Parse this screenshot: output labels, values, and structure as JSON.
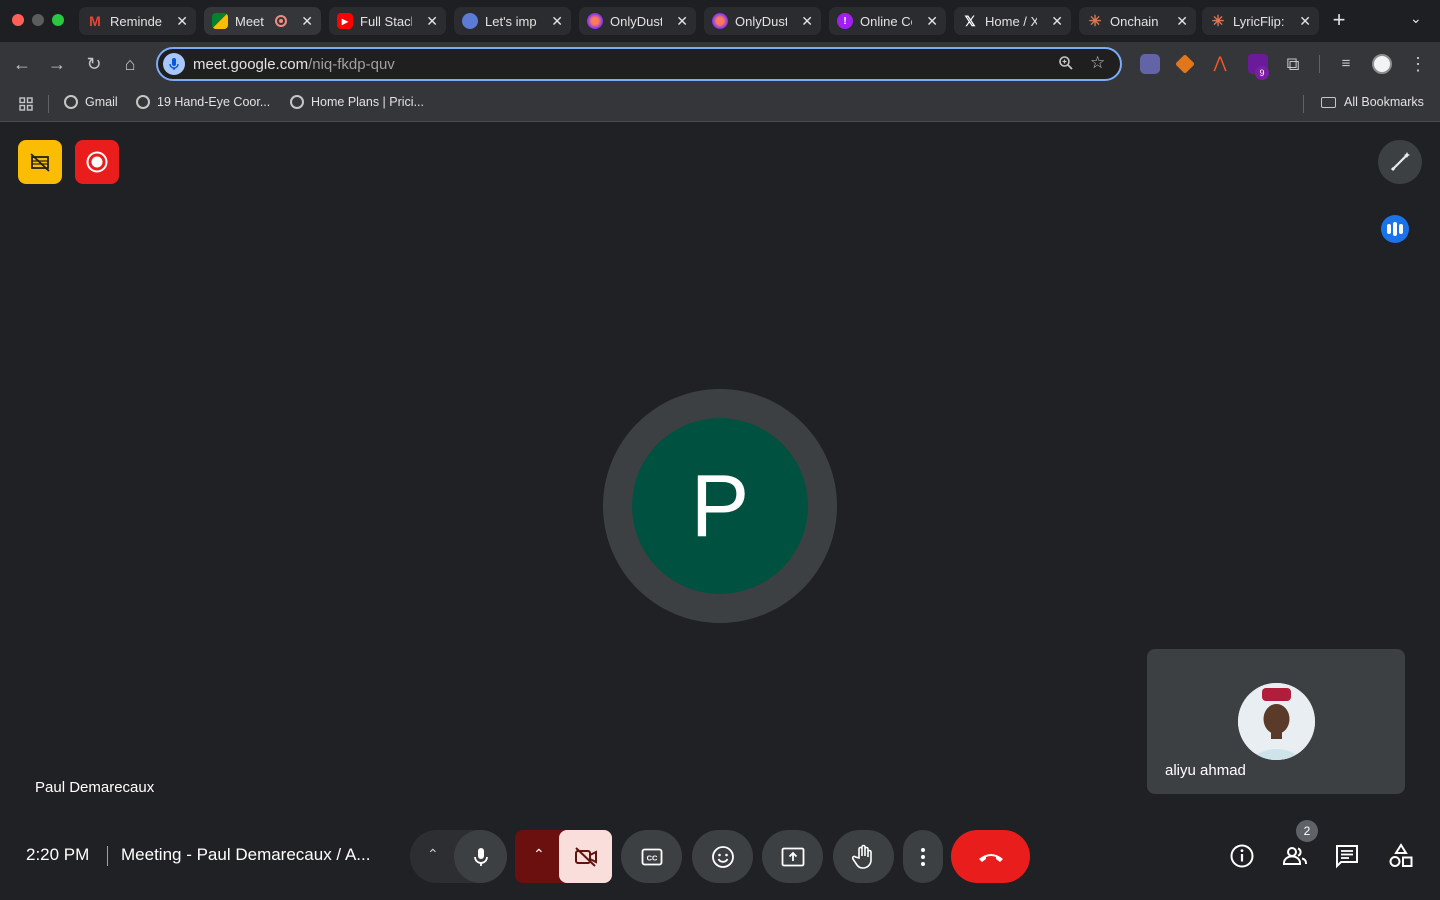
{
  "tabs": [
    {
      "title": "Reminder",
      "icon": "gmail-icon"
    },
    {
      "title": "Meet",
      "icon": "meet-icon"
    },
    {
      "title": "Full Stack",
      "icon": "youtube-icon"
    },
    {
      "title": "Let's impl",
      "icon": "github-avatar-icon"
    },
    {
      "title": "OnlyDust",
      "icon": "onlydust-icon"
    },
    {
      "title": "OnlyDust",
      "icon": "onlydust-icon"
    },
    {
      "title": "Online Co",
      "icon": "purple-shield-icon"
    },
    {
      "title": "Home / X",
      "icon": "x-icon"
    },
    {
      "title": "Onchain I",
      "icon": "claude-icon"
    },
    {
      "title": "LyricFlip:",
      "icon": "claude-icon"
    }
  ],
  "address": {
    "host": "meet.google.com",
    "path": "/niq-fkdp-quv"
  },
  "bookmarks": [
    {
      "label": "Gmail"
    },
    {
      "label": "19 Hand-Eye Coor..."
    },
    {
      "label": "Home Plans | Prici..."
    }
  ],
  "all_bookmarks": "All Bookmarks",
  "ext_badge": "9",
  "meeting": {
    "main_initial": "P",
    "main_participant": "Paul Demarecaux",
    "self_name": "aliyu ahmad",
    "time": "2:20 PM",
    "title": "Meeting - Paul Demarecaux / A...",
    "participant_count": "2"
  },
  "colors": {
    "accent_blue": "#1a73e8",
    "end_call_red": "#ea4335",
    "record_red": "#ea1d1d",
    "badge_yellow": "#fbbc04",
    "avatar_green": "#00513f"
  }
}
